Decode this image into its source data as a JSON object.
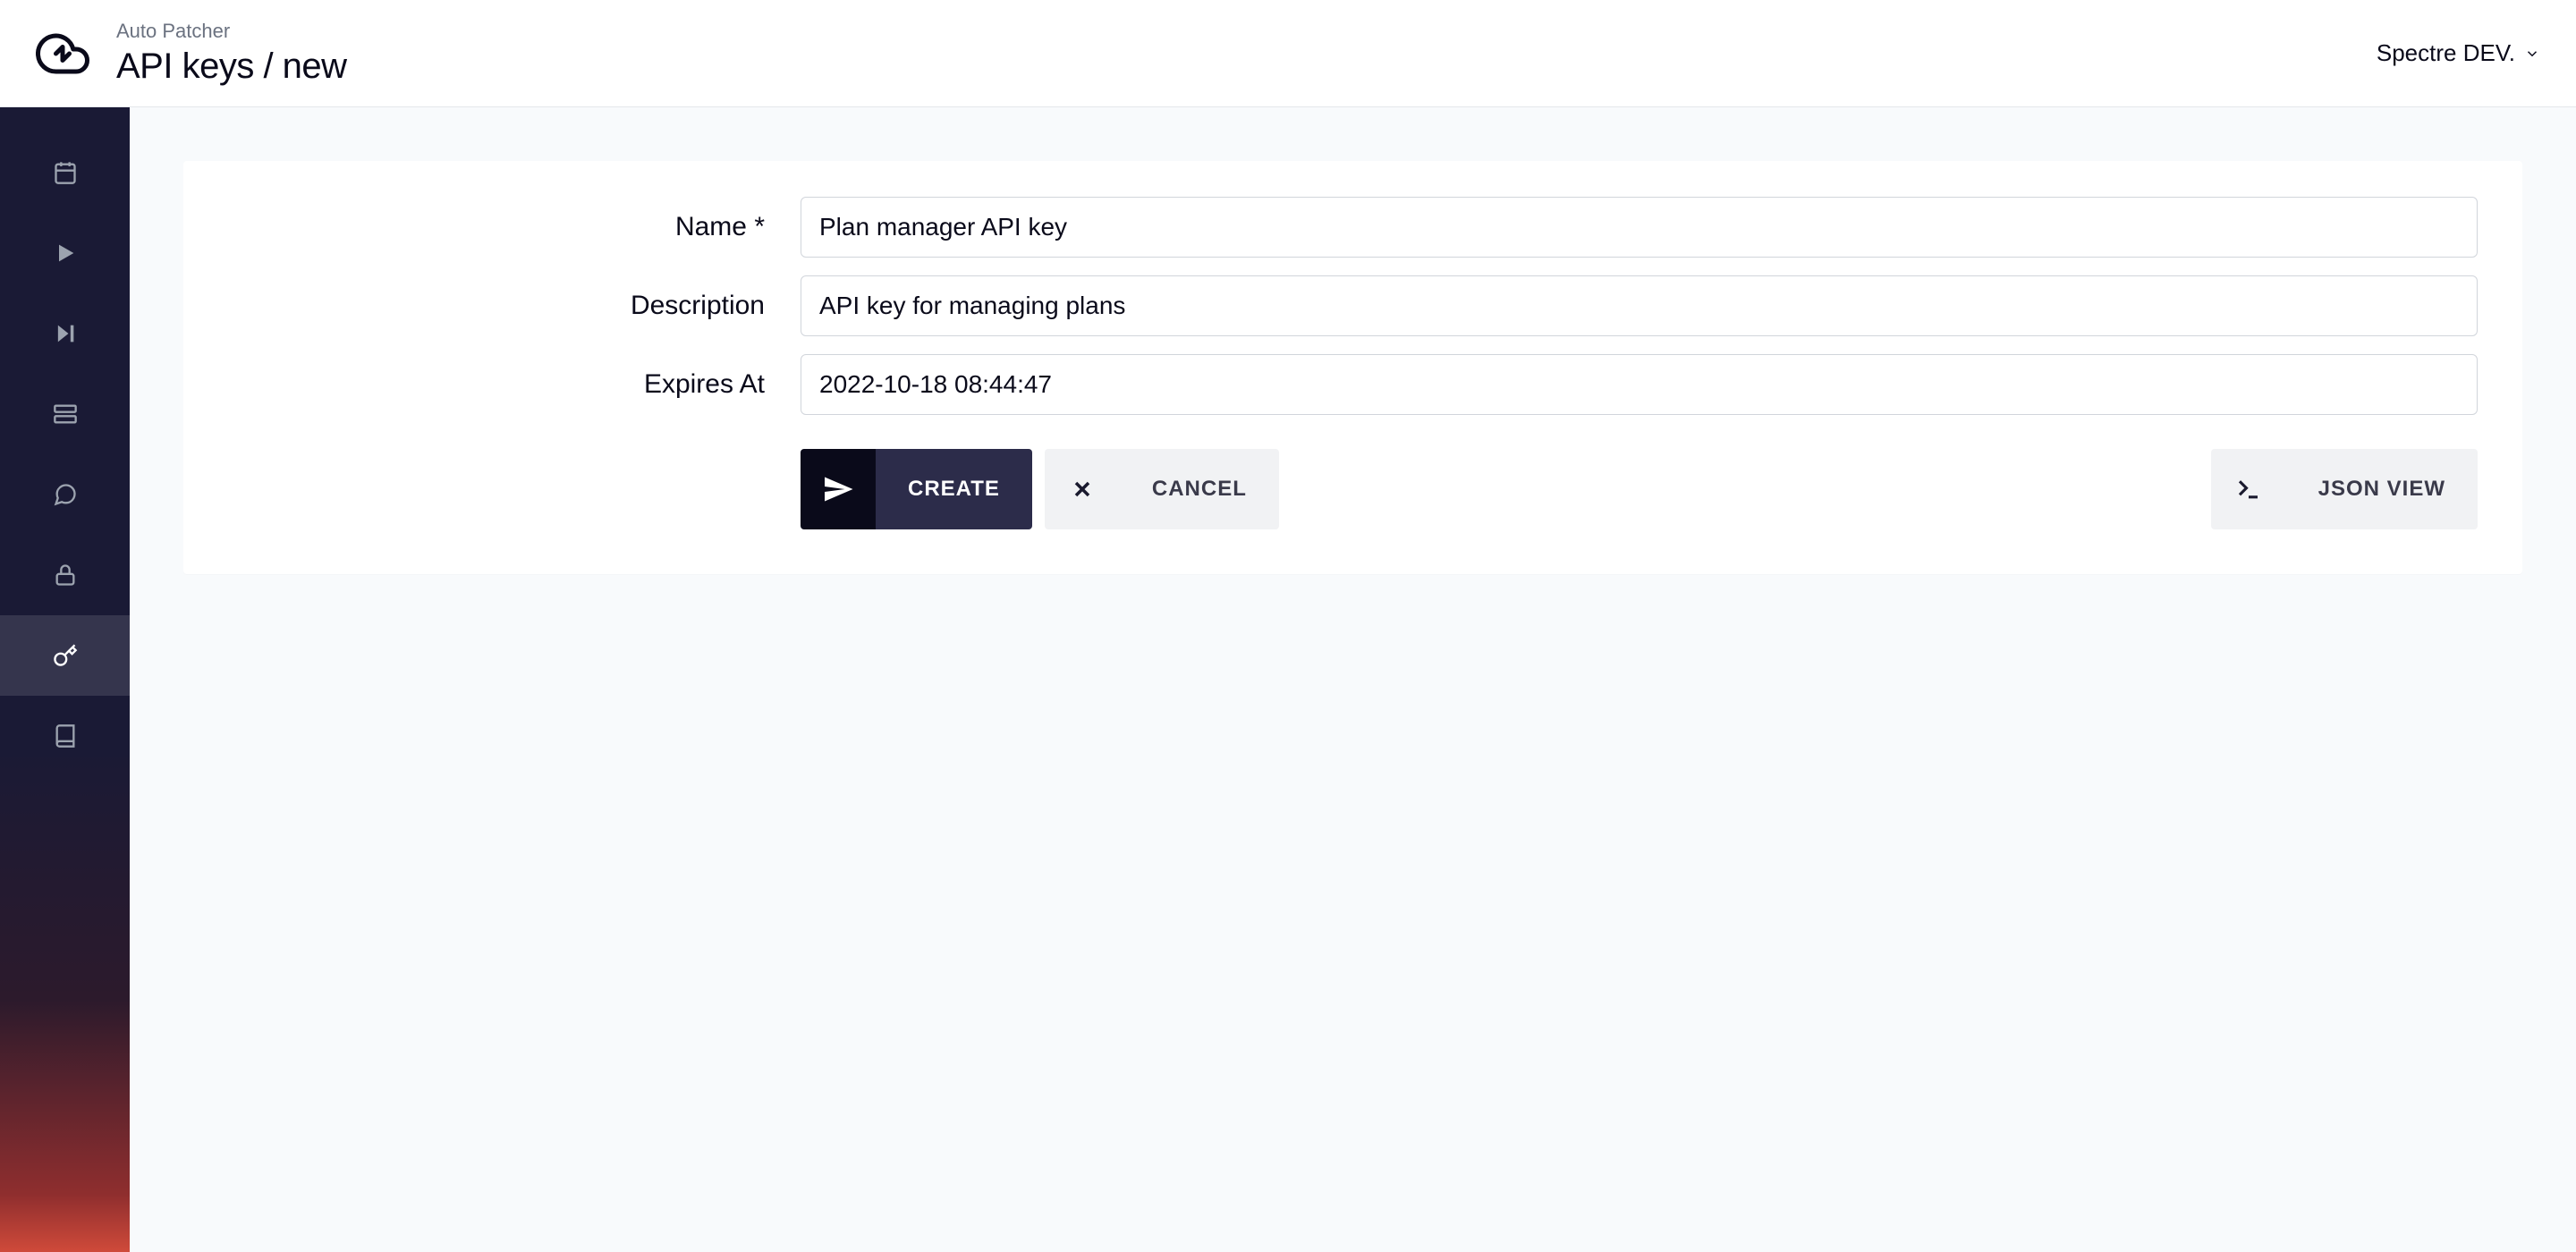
{
  "header": {
    "app_name": "Auto Patcher",
    "page_title": "API keys / new",
    "account_label": "Spectre DEV."
  },
  "sidebar": {
    "items": [
      {
        "name": "calendar",
        "active": false
      },
      {
        "name": "play",
        "active": false
      },
      {
        "name": "step",
        "active": false
      },
      {
        "name": "servers",
        "active": false
      },
      {
        "name": "chat",
        "active": false
      },
      {
        "name": "lock",
        "active": false
      },
      {
        "name": "api-keys",
        "active": true
      },
      {
        "name": "docs",
        "active": false
      }
    ]
  },
  "form": {
    "name_label": "Name *",
    "name_value": "Plan manager API key",
    "description_label": "Description",
    "description_value": "API key for managing plans",
    "expires_label": "Expires At",
    "expires_value": "2022-10-18 08:44:47"
  },
  "actions": {
    "create_label": "CREATE",
    "cancel_label": "CANCEL",
    "json_view_label": "JSON VIEW"
  }
}
